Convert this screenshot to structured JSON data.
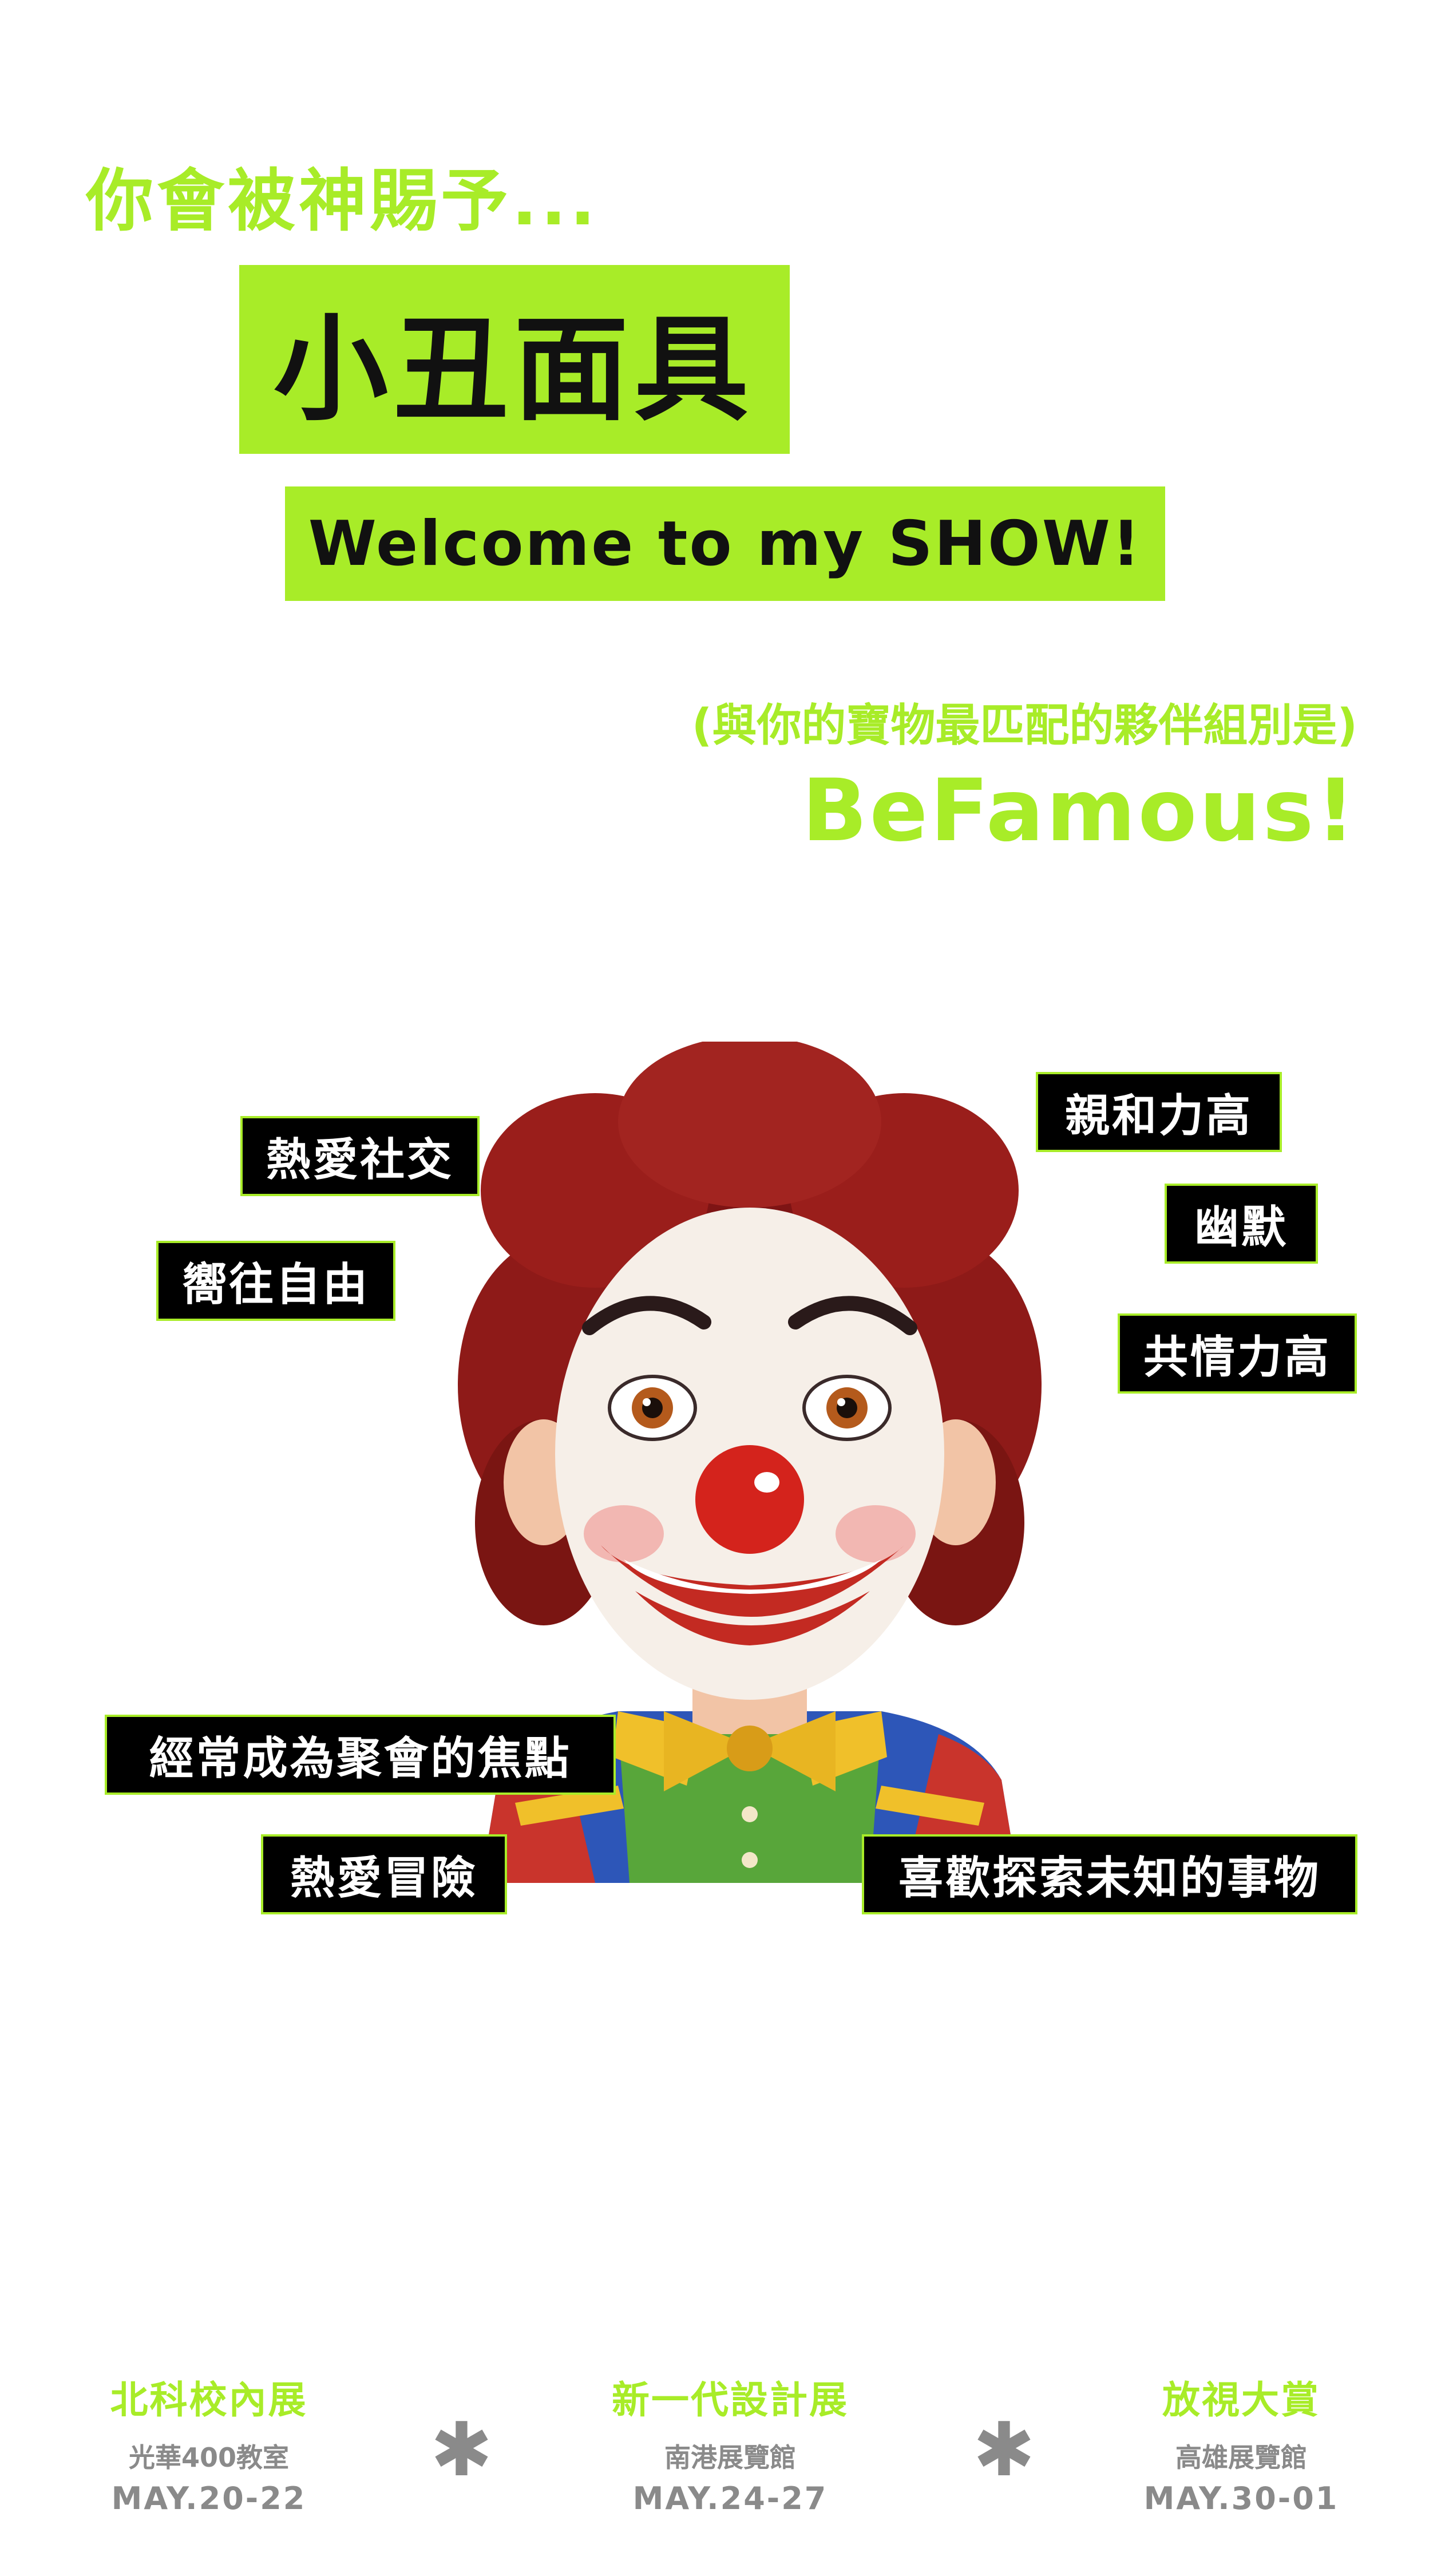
{
  "intro": "你會被神賜予...",
  "title": "小丑面具",
  "welcome": "Welcome to my SHOW!",
  "subtitle": "(與你的寶物最匹配的夥伴組別是)",
  "group_name": "BeFamous!",
  "illustration": {
    "icon": "clown-illustration"
  },
  "tags": {
    "t1": "熱愛社交",
    "t2": "嚮往自由",
    "t3": "親和力高",
    "t4": "幽默",
    "t5": "共情力高",
    "t6": "經常成為聚會的焦點",
    "t7": "熱愛冒險",
    "t8": "喜歡探索未知的事物"
  },
  "footer": {
    "separator_icon": "asterisk-icon",
    "events": [
      {
        "name": "北科校內展",
        "venue": "光華400教室",
        "date": "MAY.20-22"
      },
      {
        "name": "新一代設計展",
        "venue": "南港展覽館",
        "date": "MAY.24-27"
      },
      {
        "name": "放視大賞",
        "venue": "高雄展覽館",
        "date": "MAY.30-01"
      }
    ]
  },
  "colors": {
    "accent": "#a8ec28",
    "tag_bg": "#000000",
    "footer_gray": "#8a8a8a",
    "background": "#ffffff"
  }
}
